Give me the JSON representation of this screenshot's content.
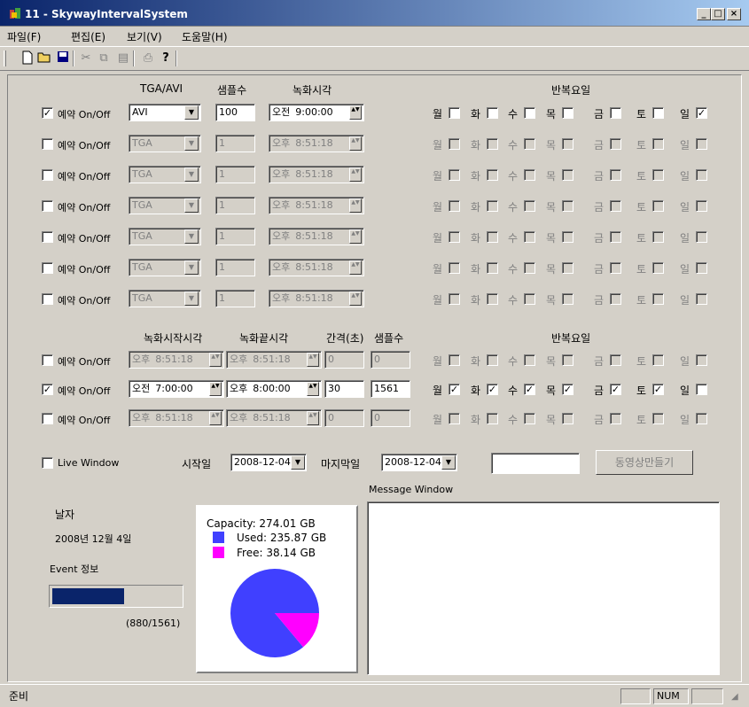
{
  "window": {
    "title": "11 - SkywayIntervalSystem",
    "min": "_",
    "max": "□",
    "close": "×"
  },
  "menu": [
    {
      "label": "파일(F)"
    },
    {
      "label": "편집(E)"
    },
    {
      "label": "보기(V)"
    },
    {
      "label": "도움말(H)"
    }
  ],
  "toolbar": {
    "icons": [
      "new-file-icon",
      "open-folder-icon",
      "save-icon",
      "cut-icon",
      "copy-icon",
      "paste-icon",
      "print-icon",
      "help-icon"
    ]
  },
  "top_headers": {
    "type": "TGA/AVI",
    "samples": "샘플수",
    "rectime": "녹화시각",
    "repeat": "반복요일"
  },
  "days": [
    "월",
    "화",
    "수",
    "목",
    "금",
    "토",
    "일"
  ],
  "reservations": [
    {
      "checked": true,
      "label": "예약 On/Off",
      "type": "AVI",
      "samples": "100",
      "ampm": "오전",
      "time": "9:00:00",
      "enabled": true,
      "days": [
        false,
        false,
        false,
        false,
        false,
        false,
        true
      ]
    },
    {
      "checked": false,
      "label": "예약 On/Off",
      "type": "TGA",
      "samples": "1",
      "ampm": "오후",
      "time": "8:51:18",
      "enabled": false,
      "days": [
        false,
        false,
        false,
        false,
        false,
        false,
        false
      ]
    },
    {
      "checked": false,
      "label": "예약 On/Off",
      "type": "TGA",
      "samples": "1",
      "ampm": "오후",
      "time": "8:51:18",
      "enabled": false,
      "days": [
        false,
        false,
        false,
        false,
        false,
        false,
        false
      ]
    },
    {
      "checked": false,
      "label": "예약 On/Off",
      "type": "TGA",
      "samples": "1",
      "ampm": "오후",
      "time": "8:51:18",
      "enabled": false,
      "days": [
        false,
        false,
        false,
        false,
        false,
        false,
        false
      ]
    },
    {
      "checked": false,
      "label": "예약 On/Off",
      "type": "TGA",
      "samples": "1",
      "ampm": "오후",
      "time": "8:51:18",
      "enabled": false,
      "days": [
        false,
        false,
        false,
        false,
        false,
        false,
        false
      ]
    },
    {
      "checked": false,
      "label": "예약 On/Off",
      "type": "TGA",
      "samples": "1",
      "ampm": "오후",
      "time": "8:51:18",
      "enabled": false,
      "days": [
        false,
        false,
        false,
        false,
        false,
        false,
        false
      ]
    },
    {
      "checked": false,
      "label": "예약 On/Off",
      "type": "TGA",
      "samples": "1",
      "ampm": "오후",
      "time": "8:51:18",
      "enabled": false,
      "days": [
        false,
        false,
        false,
        false,
        false,
        false,
        false
      ]
    }
  ],
  "interval_headers": {
    "start": "녹화시작시각",
    "end": "녹화끝시각",
    "interval": "간격(초)",
    "samples": "샘플수",
    "repeat": "반복요일"
  },
  "intervals": [
    {
      "checked": false,
      "label": "예약 On/Off",
      "start_ampm": "오후",
      "start": "8:51:18",
      "end_ampm": "오후",
      "end": "8:51:18",
      "interval": "0",
      "samples": "0",
      "enabled": false,
      "days": [
        false,
        false,
        false,
        false,
        false,
        false,
        false
      ]
    },
    {
      "checked": true,
      "label": "예약 On/Off",
      "start_ampm": "오전",
      "start": "7:00:00",
      "end_ampm": "오후",
      "end": "8:00:00",
      "interval": "30",
      "samples": "1561",
      "enabled": true,
      "days": [
        true,
        true,
        true,
        true,
        true,
        true,
        false
      ]
    },
    {
      "checked": false,
      "label": "예약 On/Off",
      "start_ampm": "오후",
      "start": "8:51:18",
      "end_ampm": "오후",
      "end": "8:51:18",
      "interval": "0",
      "samples": "0",
      "enabled": false,
      "days": [
        false,
        false,
        false,
        false,
        false,
        false,
        false
      ]
    }
  ],
  "live_window": {
    "checked": false,
    "label": "Live Window"
  },
  "dates": {
    "start_label": "시작일",
    "start": "2008-12-04",
    "end_label": "마지막일",
    "end": "2008-12-04"
  },
  "make_video": {
    "input": "",
    "button": "동영상만들기"
  },
  "message_window": {
    "label": "Message Window"
  },
  "info": {
    "date_label": "날자",
    "date": "2008년 12월 4일",
    "event_label": "Event 정보",
    "progress_text": "(880/1561)",
    "progress": 0.5637
  },
  "disk": {
    "capacity": "Capacity: 274.01 GB",
    "used": "Used: 235.87 GB",
    "free": "Free: 38.14 GB",
    "used_color": "#4040ff",
    "free_color": "#ff00ff",
    "used_fraction": 0.8608
  },
  "status": {
    "ready": "준비",
    "num": "NUM"
  }
}
